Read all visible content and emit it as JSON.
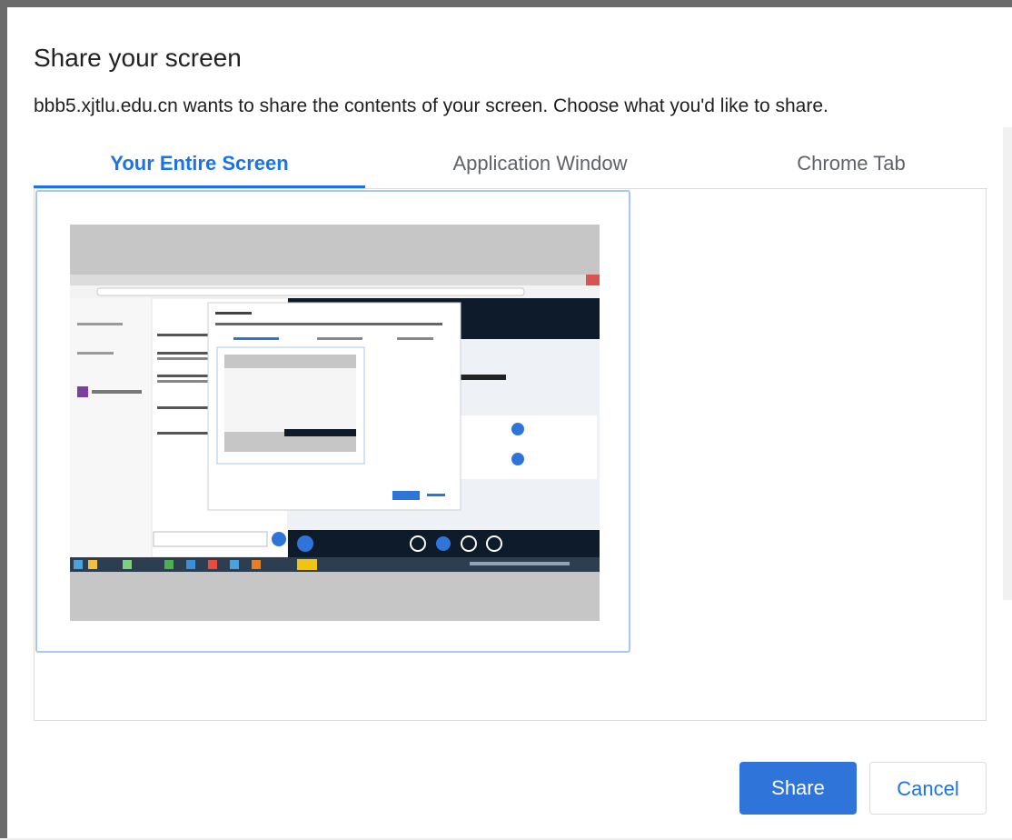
{
  "dialog": {
    "title": "Share your screen",
    "description": "bbb5.xjtlu.edu.cn wants to share the contents of your screen. Choose what you'd like to share."
  },
  "tabs": [
    {
      "label": "Your Entire Screen",
      "active": true
    },
    {
      "label": "Application Window",
      "active": false
    },
    {
      "label": "Chrome Tab",
      "active": false
    }
  ],
  "buttons": {
    "share_label": "Share",
    "cancel_label": "Cancel"
  },
  "colors": {
    "accent": "#1a73e8",
    "share_button": "#2f74d8",
    "selection_border": "#a9c7f5"
  }
}
